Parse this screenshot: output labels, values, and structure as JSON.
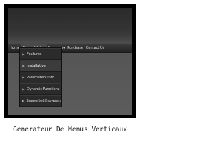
{
  "menubar": {
    "items": [
      {
        "label": "Home",
        "caret": ""
      },
      {
        "label": "Product Info",
        "caret": "▾"
      },
      {
        "label": "Samples",
        "caret": "▾"
      },
      {
        "label": "Purchase",
        "caret": ""
      },
      {
        "label": "Contact Us",
        "caret": ""
      }
    ]
  },
  "submenu": {
    "arrow_glyph": "▶",
    "items": [
      {
        "label": "Features"
      },
      {
        "label": "Installation"
      },
      {
        "label": "Parameters Info"
      },
      {
        "label": "Dynamic Functions"
      },
      {
        "label": "Supported Browsers"
      }
    ]
  },
  "caption": "Generateur De Menus Verticaux"
}
